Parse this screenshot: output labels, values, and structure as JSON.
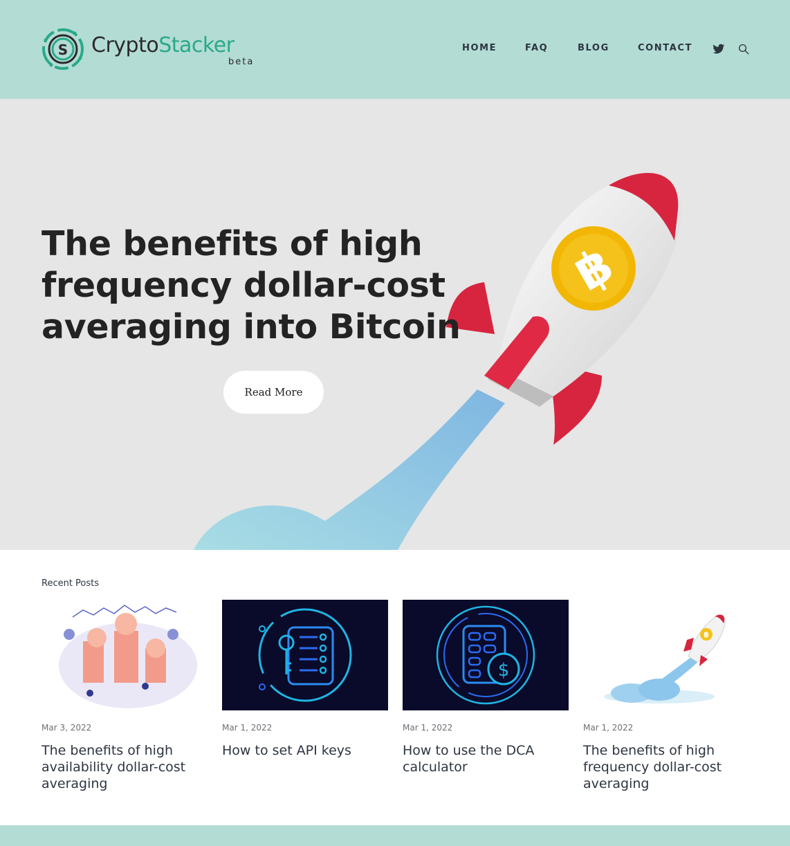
{
  "brand": {
    "name_part1": "Crypto",
    "name_part2": "Stacker",
    "tag": "beta",
    "accent_color": "#2aa98a",
    "header_bg": "#b3dcd4"
  },
  "nav": {
    "items": [
      {
        "label": "HOME"
      },
      {
        "label": "FAQ"
      },
      {
        "label": "BLOG"
      },
      {
        "label": "CONTACT"
      }
    ],
    "icons": [
      "twitter-icon",
      "search-icon"
    ]
  },
  "hero": {
    "title": "The benefits of high frequency dollar-cost averaging into Bitcoin",
    "cta_label": "Read More",
    "background": "#e6e6e6"
  },
  "recent": {
    "label": "Recent Posts",
    "posts": [
      {
        "date": "Mar 3, 2022",
        "title": "The benefits of high availability dollar-cost averaging",
        "image": "crypto-coins-illustration"
      },
      {
        "date": "Mar 1, 2022",
        "title": "How to set API keys",
        "image": "api-key-icon-illustration"
      },
      {
        "date": "Mar 1, 2022",
        "title": "How to use the DCA calculator",
        "image": "calculator-icon-illustration"
      },
      {
        "date": "Mar 1, 2022",
        "title": "The benefits of high frequency dollar-cost averaging",
        "image": "bitcoin-rocket-illustration"
      }
    ]
  }
}
